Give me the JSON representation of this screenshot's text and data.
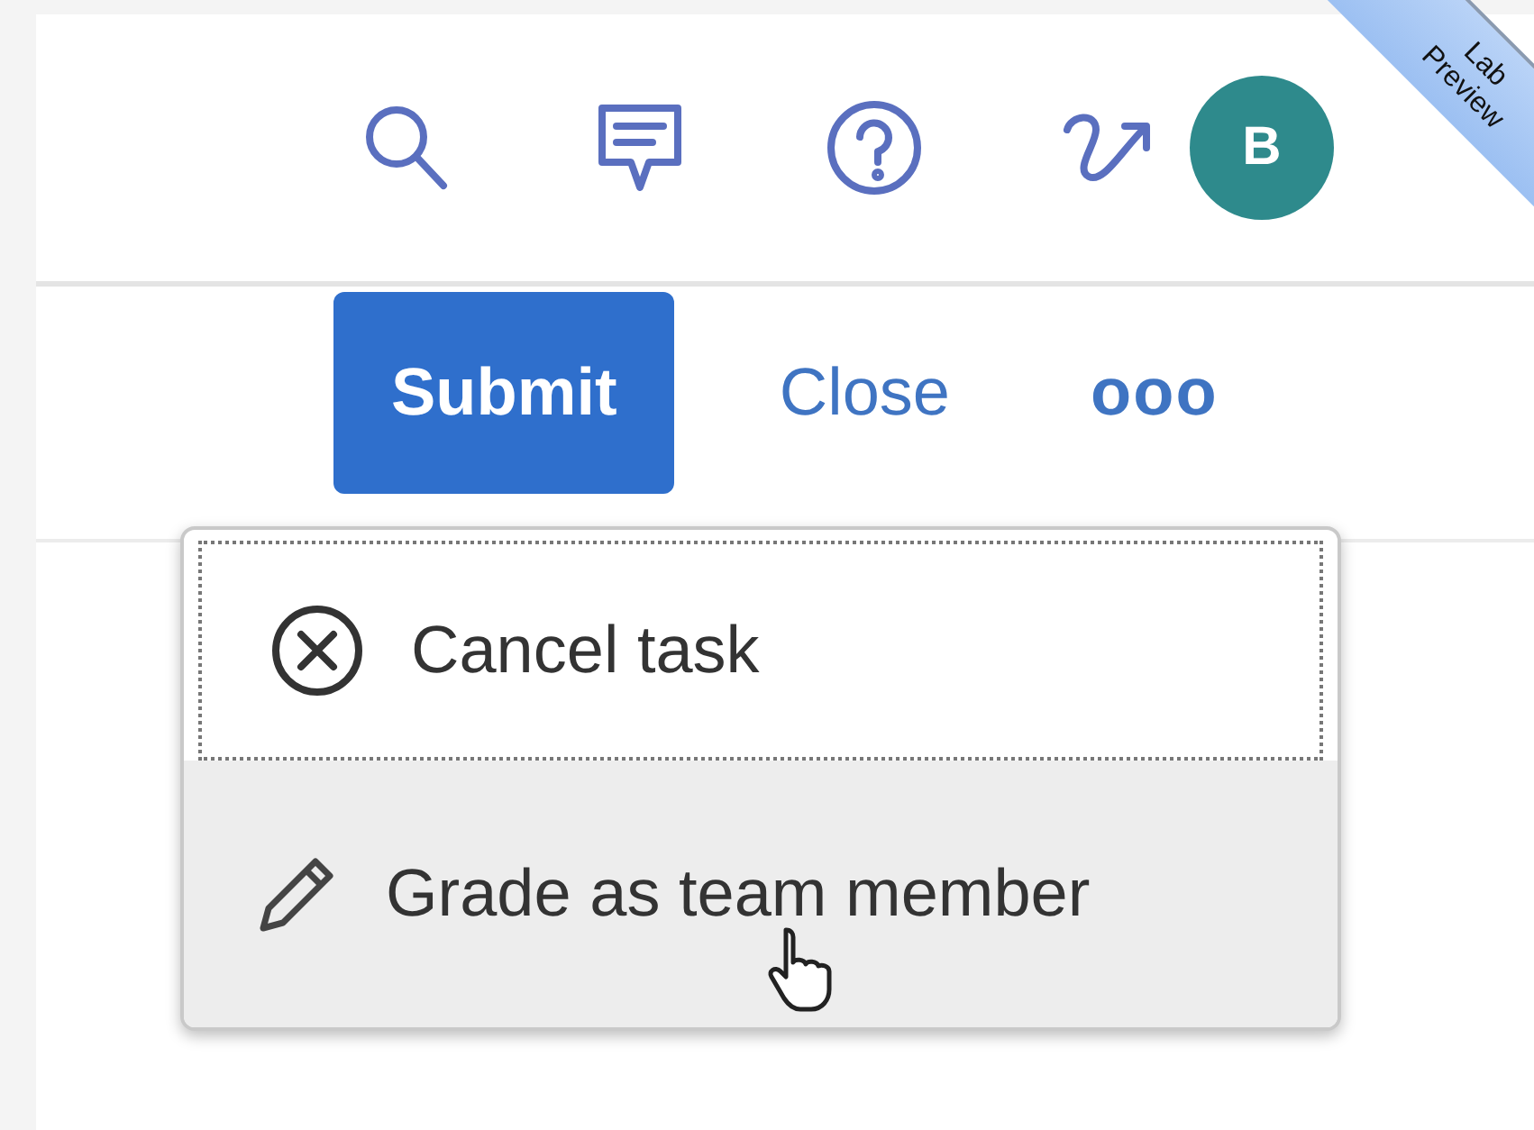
{
  "header": {
    "actions": [
      {
        "kind": "search"
      },
      {
        "kind": "feedback"
      },
      {
        "kind": "help"
      },
      {
        "kind": "share"
      }
    ],
    "avatar": {
      "initial": "B"
    },
    "ribbon": {
      "lines": [
        "Lab",
        "Preview"
      ]
    }
  },
  "toolbar": {
    "buttons": [
      {
        "label": "Submit",
        "kind": "primary"
      },
      {
        "label": "Close",
        "kind": "link"
      },
      {
        "label": "ooo",
        "kind": "overflow"
      }
    ]
  },
  "menu": {
    "items": [
      {
        "label": "Cancel task",
        "kind": "cancel",
        "focused": true,
        "hovered": false
      },
      {
        "label": "Grade as team member",
        "kind": "edit",
        "focused": false,
        "hovered": true
      }
    ]
  }
}
